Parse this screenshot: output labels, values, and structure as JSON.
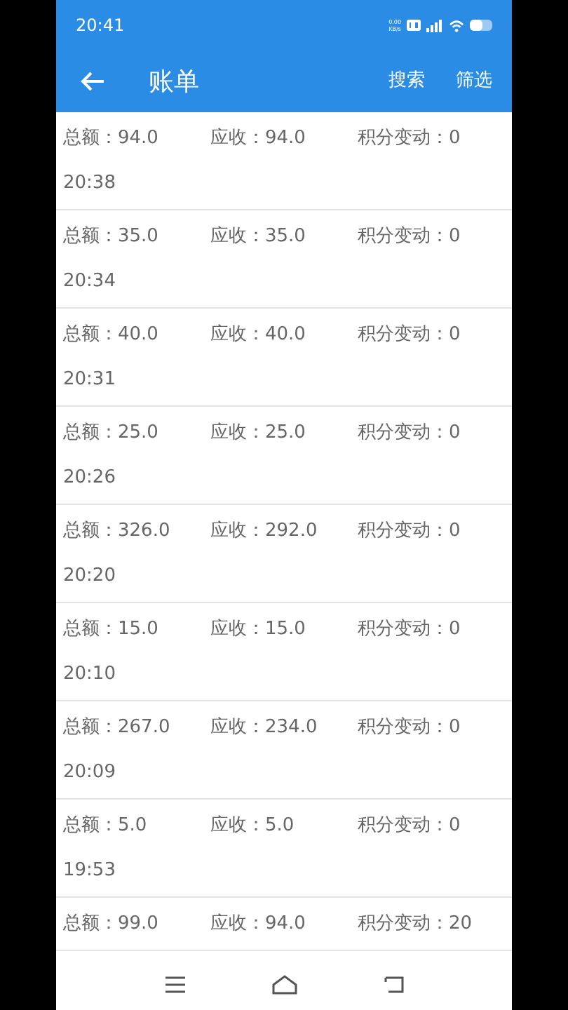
{
  "status_bar": {
    "time": "20:41",
    "speed": "0.00\nKB/s"
  },
  "header": {
    "title": "账单",
    "actions": [
      "搜索",
      "筛选"
    ]
  },
  "bills": [
    {
      "total": "总额：94.0",
      "receivable": "应收：94.0",
      "points": "积分变动：0",
      "time": "20:38"
    },
    {
      "total": "总额：35.0",
      "receivable": "应收：35.0",
      "points": "积分变动：0",
      "time": "20:34"
    },
    {
      "total": "总额：40.0",
      "receivable": "应收：40.0",
      "points": "积分变动：0",
      "time": "20:31"
    },
    {
      "total": "总额：25.0",
      "receivable": "应收：25.0",
      "points": "积分变动：0",
      "time": "20:26"
    },
    {
      "total": "总额：326.0",
      "receivable": "应收：292.0",
      "points": "积分变动：0",
      "time": "20:20"
    },
    {
      "total": "总额：15.0",
      "receivable": "应收：15.0",
      "points": "积分变动：0",
      "time": "20:10"
    },
    {
      "total": "总额：267.0",
      "receivable": "应收：234.0",
      "points": "积分变动：0",
      "time": "20:09"
    },
    {
      "total": "总额：5.0",
      "receivable": "应收：5.0",
      "points": "积分变动：0",
      "time": "19:53"
    },
    {
      "total": "总额：99.0",
      "receivable": "应收：94.0",
      "points": "积分变动：20"
    }
  ]
}
